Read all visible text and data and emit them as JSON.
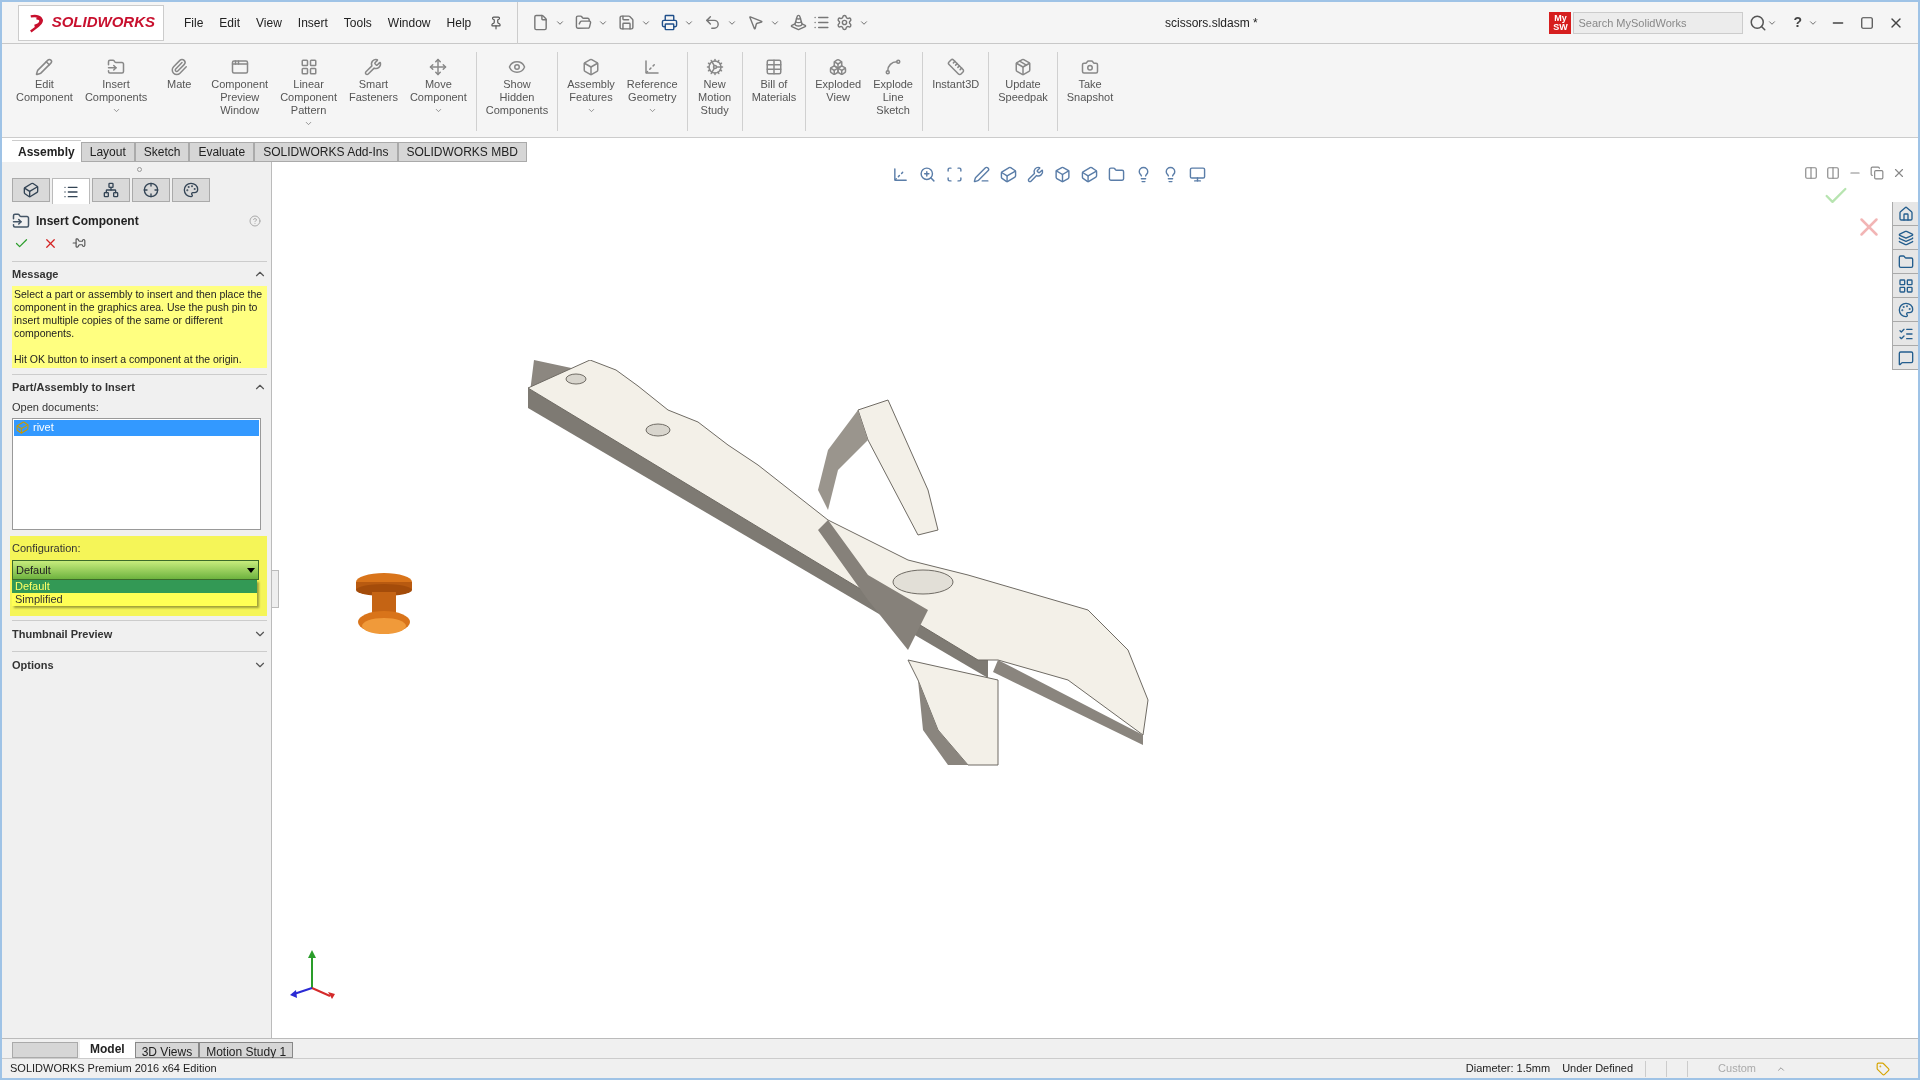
{
  "app": {
    "logo": "SOLIDWORKS"
  },
  "menu": [
    "File",
    "Edit",
    "View",
    "Insert",
    "Tools",
    "Window",
    "Help"
  ],
  "document_title": "scissors.sldasm *",
  "search": {
    "badge": "My SW",
    "placeholder": "Search MySolidWorks"
  },
  "help_button": "?",
  "ribbon": [
    {
      "label": "Edit\nComponent",
      "has_menu": false,
      "separator_before": false
    },
    {
      "label": "Insert\nComponents",
      "has_menu": true,
      "separator_before": false
    },
    {
      "label": "Mate",
      "has_menu": false,
      "separator_before": false
    },
    {
      "label": "Component\nPreview\nWindow",
      "has_menu": false,
      "separator_before": false
    },
    {
      "label": "Linear\nComponent\nPattern",
      "has_menu": true,
      "separator_before": false
    },
    {
      "label": "Smart\nFasteners",
      "has_menu": false,
      "separator_before": false
    },
    {
      "label": "Move\nComponent",
      "has_menu": true,
      "separator_before": false
    },
    {
      "label": "Show\nHidden\nComponents",
      "has_menu": false,
      "separator_before": true
    },
    {
      "label": "Assembly\nFeatures",
      "has_menu": true,
      "separator_before": true
    },
    {
      "label": "Reference\nGeometry",
      "has_menu": true,
      "separator_before": false
    },
    {
      "label": "New\nMotion\nStudy",
      "has_menu": false,
      "separator_before": true
    },
    {
      "label": "Bill of\nMaterials",
      "has_menu": false,
      "separator_before": true
    },
    {
      "label": "Exploded\nView",
      "has_menu": false,
      "separator_before": true
    },
    {
      "label": "Explode\nLine\nSketch",
      "has_menu": false,
      "separator_before": false
    },
    {
      "label": "Instant3D",
      "has_menu": false,
      "separator_before": true
    },
    {
      "label": "Update\nSpeedpak",
      "has_menu": false,
      "separator_before": true
    },
    {
      "label": "Take\nSnapshot",
      "has_menu": false,
      "separator_before": true
    }
  ],
  "tabs": [
    {
      "label": "Assembly",
      "selected": true
    },
    {
      "label": "Layout",
      "selected": false
    },
    {
      "label": "Sketch",
      "selected": false
    },
    {
      "label": "Evaluate",
      "selected": false
    },
    {
      "label": "SOLIDWORKS Add-Ins",
      "selected": false
    },
    {
      "label": "SOLIDWORKS MBD",
      "selected": false
    }
  ],
  "panel_tabs": [
    {
      "selected": false
    },
    {
      "selected": true
    },
    {
      "selected": false
    },
    {
      "selected": false
    },
    {
      "selected": false
    }
  ],
  "property_manager": {
    "title": "Insert Component",
    "message": {
      "title": "Message",
      "expanded": true,
      "paragraphs": [
        "Select a part or assembly to insert and then place the component in the graphics area. Use the push pin to insert multiple copies of the same or different components.",
        "Hit OK button to insert a component at the origin."
      ]
    },
    "part_section": {
      "title": "Part/Assembly to Insert",
      "expanded": true,
      "open_documents_label": "Open documents:",
      "documents": [
        {
          "name": "rivet",
          "selected": true
        }
      ],
      "configuration_label": "Configuration:",
      "configuration_value": "Default",
      "configuration_options": [
        {
          "label": "Default",
          "selected": true
        },
        {
          "label": "Simplified",
          "selected": false
        }
      ]
    },
    "collapsed_sections": [
      {
        "title": "Thumbnail Preview",
        "expanded": false
      },
      {
        "title": "Options",
        "expanded": false
      }
    ]
  },
  "bottom_tabs": [
    {
      "label": "Model",
      "selected": true
    },
    {
      "label": "3D Views",
      "selected": false
    },
    {
      "label": "Motion Study 1",
      "selected": false
    }
  ],
  "status_bar": {
    "edition": "SOLIDWORKS Premium 2016 x64 Edition",
    "items": [
      "Diameter: 1.5mm",
      "Under Defined"
    ],
    "units": "Custom"
  }
}
